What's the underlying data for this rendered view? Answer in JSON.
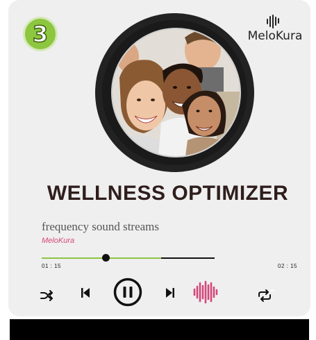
{
  "badge": {
    "number": "3"
  },
  "brand": {
    "name": "MeloKura",
    "icon": "heartbeat-icon"
  },
  "cover": {
    "alt_icon": "group-photo"
  },
  "track": {
    "title": "WELLNESS OPTIMIZER",
    "subtitle": "frequency sound streams",
    "artist": "MeloKura"
  },
  "progress": {
    "elapsed": "01 : 15",
    "total": "02 : 15",
    "played_fraction": 0.37,
    "buffered_fraction": 0.69
  },
  "controls": {
    "shuffle": "shuffle-icon",
    "previous": "skip-previous-icon",
    "play_pause": "pause-icon",
    "next": "skip-next-icon",
    "equalizer": "equalizer-icon",
    "repeat": "repeat-icon"
  },
  "colors": {
    "accent_green": "#8dc63f",
    "accent_pink": "#d4477a",
    "title": "#2f1e1c",
    "card": "#efefef"
  }
}
